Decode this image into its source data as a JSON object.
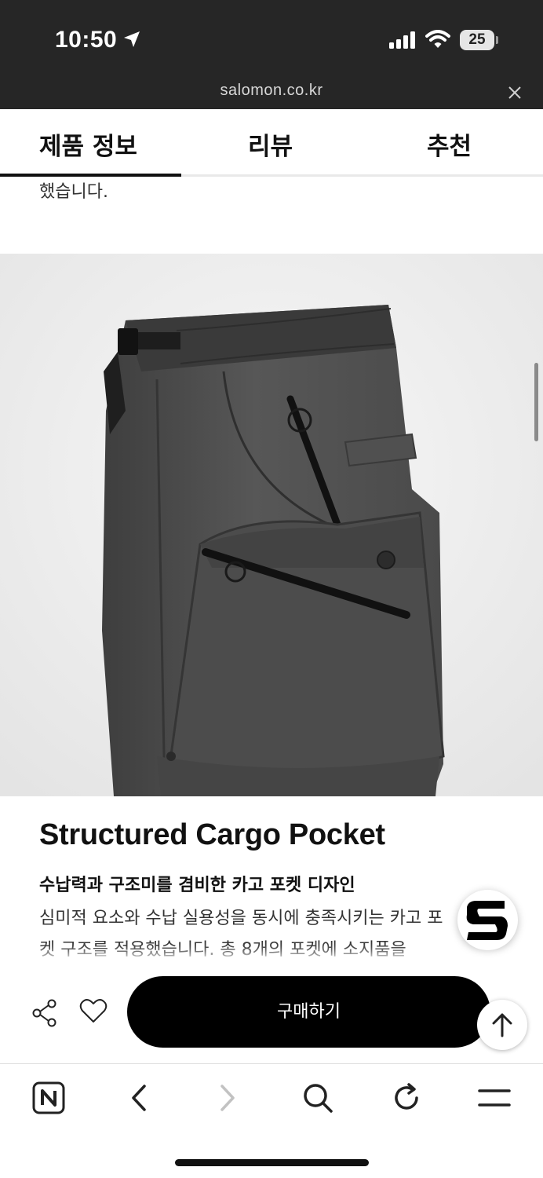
{
  "status": {
    "time": "10:50",
    "battery": "25"
  },
  "browser": {
    "url": "salomon.co.kr"
  },
  "tabs": [
    {
      "label": "제품 정보",
      "active": true
    },
    {
      "label": "리뷰",
      "active": false
    },
    {
      "label": "추천",
      "active": false
    }
  ],
  "content": {
    "prev_text": "했습니다.",
    "feature_title": "Structured Cargo Pocket",
    "feature_subtitle": "수납력과 구조미를 겸비한 카고 포켓 디자인",
    "feature_body": "심미적 요소와 수납 실용성을 동시에 충족시키는 카고 포켓 구조를 적용했습니다. 총 8개의 포켓에 소지품을"
  },
  "actions": {
    "buy_label": "구매하기"
  },
  "icons": {
    "status": [
      "location-arrow-icon",
      "signal-icon",
      "wifi-icon",
      "battery-icon"
    ],
    "bottom": [
      "share-icon",
      "heart-icon",
      "scroll-top-icon"
    ],
    "browser_nav": [
      "naver-n-icon",
      "back-icon",
      "forward-icon",
      "search-icon",
      "refresh-icon",
      "menu-icon"
    ]
  },
  "colors": {
    "status_bg": "#262626",
    "button": "#000000",
    "accent_text": "#111111"
  }
}
